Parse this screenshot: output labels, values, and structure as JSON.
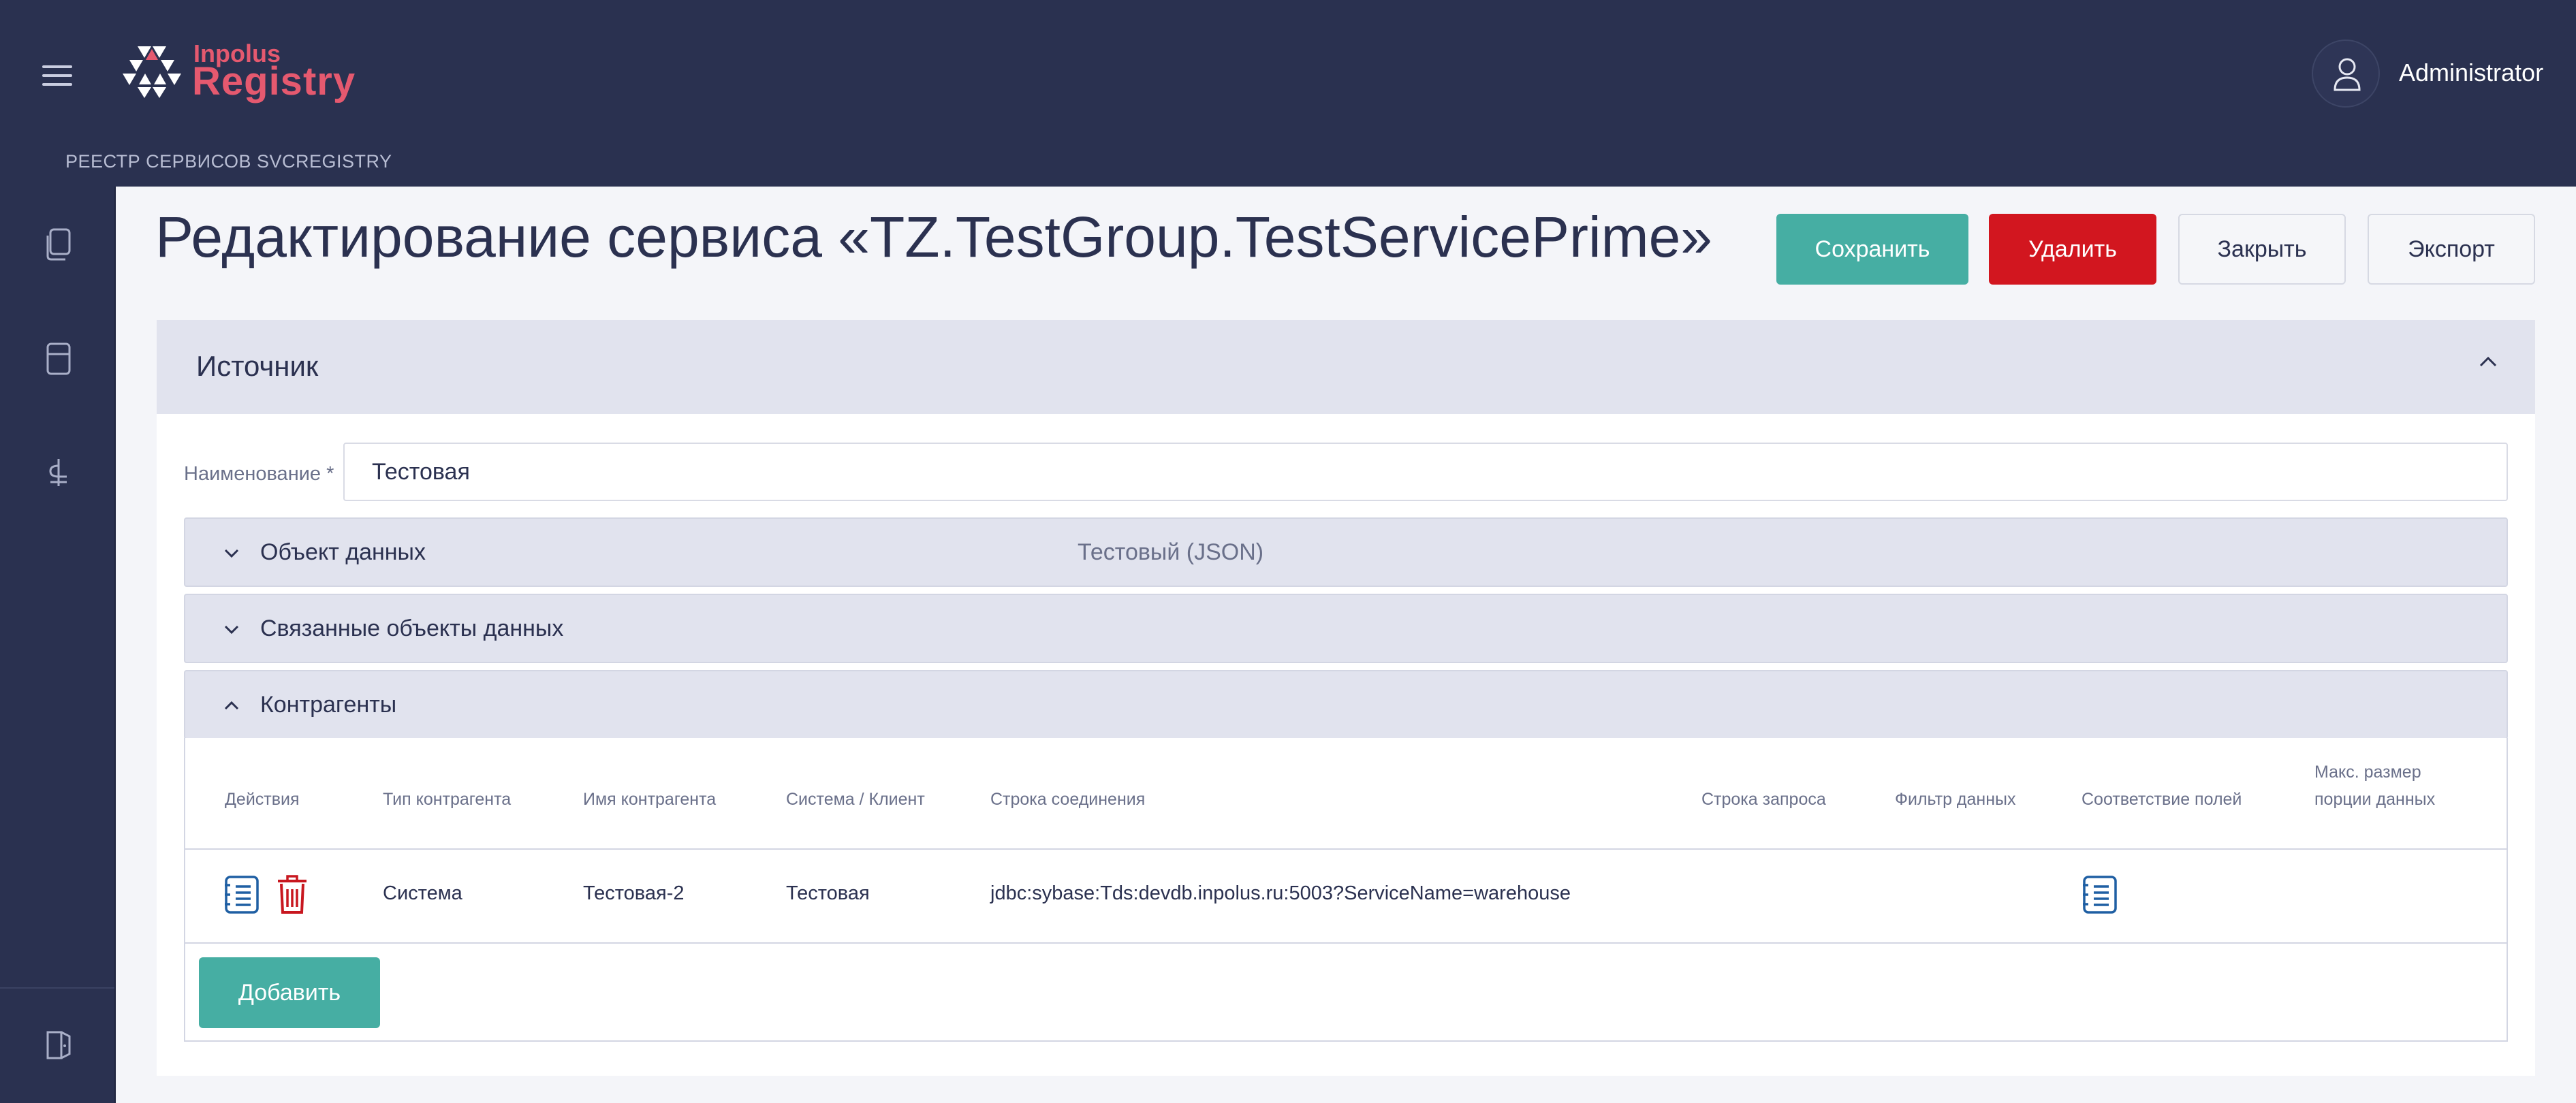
{
  "app": {
    "logo_top": "Inpolus",
    "logo_main": "Registry",
    "breadcrumb": "РЕЕСТР СЕРВИСОВ SVCREGISTRY",
    "user_name": "Administrator"
  },
  "sidebar": {
    "items": [
      "documents-icon",
      "storage-icon",
      "connections-icon"
    ],
    "bottom": "logout-icon"
  },
  "page": {
    "title": "Редактирование сервиса «TZ.TestGroup.TestServicePrime»"
  },
  "toolbar": {
    "save_label": "Сохранить",
    "delete_label": "Удалить",
    "close_label": "Закрыть",
    "export_label": "Экспорт"
  },
  "source": {
    "section_title": "Источник",
    "name_label": "Наименование *",
    "name_value": "Тестовая",
    "data_object_label": "Объект данных",
    "data_object_value": "Тестовый (JSON)",
    "related_label": "Связанные объекты данных",
    "contractors_label": "Контрагенты"
  },
  "contractors_table": {
    "columns": [
      "Действия",
      "Тип контрагента",
      "Имя контрагента",
      "Система / Клиент",
      "Строка соединения",
      "Строка запроса",
      "Фильтр данных",
      "Соответствие полей",
      "Макс. размер",
      "порции данных"
    ],
    "rows": [
      {
        "type": "Система",
        "name": "Тестовая-2",
        "system": "Тестовая",
        "connection": "jdbc:sybase:Tds:devdb.inpolus.ru:5003?ServiceName=warehouse",
        "query": "",
        "filter": "",
        "max_size": ""
      }
    ],
    "add_label": "Добавить"
  },
  "colors": {
    "header_bg": "#2a3150",
    "brand": "#e5596f",
    "primary": "#46aea3",
    "danger": "#d2161f",
    "edit_icon": "#1f5fa3"
  }
}
